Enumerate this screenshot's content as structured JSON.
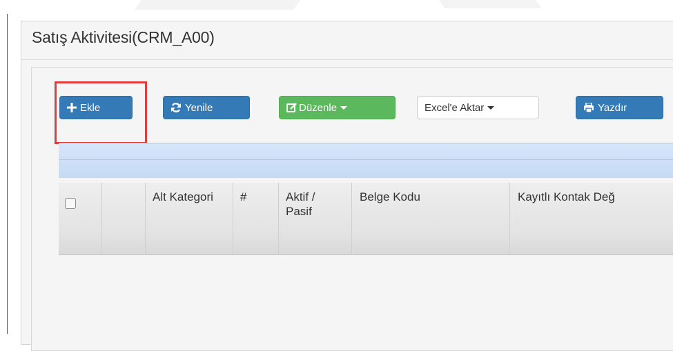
{
  "panel": {
    "title": "Satış Aktivitesi(CRM_A00)"
  },
  "toolbar": {
    "add_label": "Ekle",
    "refresh_label": "Yenile",
    "edit_label": "Düzenle",
    "export_label": "Excel'e Aktar",
    "print_label": "Yazdır"
  },
  "table": {
    "columns": [
      "",
      "Alt Kategori",
      "#",
      "Aktif / Pasif",
      "Belge Kodu",
      "Kayıtlı Kontak Değ"
    ]
  },
  "icons": {
    "add": "plus-icon",
    "refresh": "refresh-icon",
    "edit": "edit-icon",
    "export": "caret-down-icon",
    "print": "print-icon"
  },
  "colors": {
    "primary": "#337ab7",
    "success": "#5cb85c",
    "highlight": "#e03c3c"
  }
}
